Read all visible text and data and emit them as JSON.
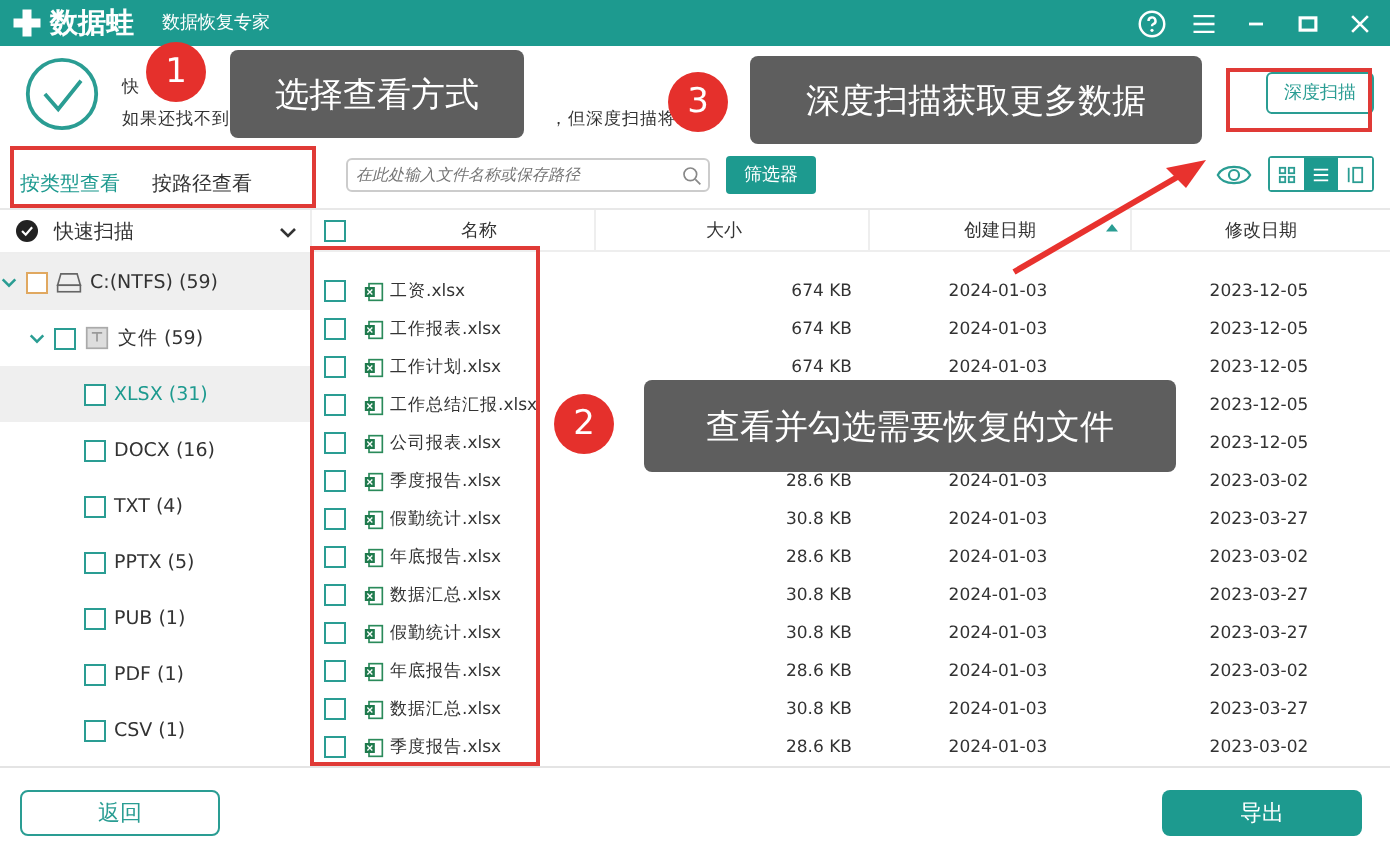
{
  "window": {
    "app_name": "数据蛙",
    "subtitle": "数据恢复专家"
  },
  "header": {
    "line_1": "快",
    "line_2_start": "如果还找不到",
    "line_2_end": "，但深度扫描将",
    "deep_scan_button": "深度扫描"
  },
  "view_tabs": [
    {
      "label": "按类型查看",
      "selected": true
    },
    {
      "label": "按路径查看",
      "selected": false
    }
  ],
  "search": {
    "placeholder": "在此处输入文件名称或保存路径"
  },
  "filter_button": "筛选器",
  "view_modes": [
    {
      "kind": "grid",
      "selected": false
    },
    {
      "kind": "list",
      "selected": true
    },
    {
      "kind": "columns",
      "selected": false
    }
  ],
  "sidebar": {
    "title": "快速扫描",
    "tree": [
      {
        "label": "C:(NTFS) (59)",
        "kind": "drive",
        "expanded": true,
        "checked": false,
        "selected": false,
        "children": [
          {
            "label": "文件 (59)",
            "kind": "folder",
            "expanded": true,
            "checked": false,
            "selected": false,
            "children": [
              {
                "label": "XLSX (31)",
                "checked": false,
                "selected": true
              },
              {
                "label": "DOCX (16)",
                "checked": false,
                "selected": false
              },
              {
                "label": "TXT (4)",
                "checked": false,
                "selected": false
              },
              {
                "label": "PPTX (5)",
                "checked": false,
                "selected": false
              },
              {
                "label": "PUB (1)",
                "checked": false,
                "selected": false
              },
              {
                "label": "PDF (1)",
                "checked": false,
                "selected": false
              },
              {
                "label": "CSV (1)",
                "checked": false,
                "selected": false
              }
            ]
          }
        ]
      }
    ]
  },
  "table": {
    "all_checked": false,
    "columns": [
      "名称",
      "大小",
      "创建日期",
      "修改日期"
    ],
    "rows": [
      {
        "name": "工资.xlsx",
        "size": "674 KB",
        "created": "2024-01-03",
        "modified": "2023-12-05",
        "checked": false
      },
      {
        "name": "工作报表.xlsx",
        "size": "674 KB",
        "created": "2024-01-03",
        "modified": "2023-12-05",
        "checked": false
      },
      {
        "name": "工作计划.xlsx",
        "size": "674 KB",
        "created": "2024-01-03",
        "modified": "2023-12-05",
        "checked": false
      },
      {
        "name": "工作总结汇报.xlsx",
        "modified": "2023-12-05",
        "checked": false
      },
      {
        "name": "公司报表.xlsx",
        "modified": "2023-12-05",
        "checked": false
      },
      {
        "name": "季度报告.xlsx",
        "size": "28.6 KB",
        "created": "2024-01-03",
        "modified": "2023-03-02",
        "checked": false
      },
      {
        "name": "假勤统计.xlsx",
        "size": "30.8 KB",
        "created": "2024-01-03",
        "modified": "2023-03-27",
        "checked": false
      },
      {
        "name": "年底报告.xlsx",
        "size": "28.6 KB",
        "created": "2024-01-03",
        "modified": "2023-03-02",
        "checked": false
      },
      {
        "name": "数据汇总.xlsx",
        "size": "30.8 KB",
        "created": "2024-01-03",
        "modified": "2023-03-27",
        "checked": false
      },
      {
        "name": "假勤统计.xlsx",
        "size": "30.8 KB",
        "created": "2024-01-03",
        "modified": "2023-03-27",
        "checked": false
      },
      {
        "name": "年底报告.xlsx",
        "size": "28.6 KB",
        "created": "2024-01-03",
        "modified": "2023-03-02",
        "checked": false
      },
      {
        "name": "数据汇总.xlsx",
        "size": "30.8 KB",
        "created": "2024-01-03",
        "modified": "2023-03-27",
        "checked": false
      },
      {
        "name": "季度报告.xlsx",
        "size": "28.6 KB",
        "created": "2024-01-03",
        "modified": "2023-03-02",
        "checked": false
      }
    ]
  },
  "footer": {
    "back_button": "返回",
    "export_button": "导出"
  },
  "callouts": [
    {
      "number": "1",
      "text": "选择查看方式"
    },
    {
      "number": "3",
      "text": "深度扫描获取更多数据"
    },
    {
      "number": "2",
      "text": "查看并勾选需要恢复的文件"
    }
  ]
}
